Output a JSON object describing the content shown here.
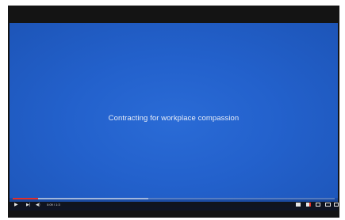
{
  "video": {
    "background_color": "#2361cc",
    "slide_text": "Contracting for workplace compassion"
  },
  "controls": {
    "progress_played_fraction": 0.08,
    "progress_buffered_fraction": 0.42,
    "progress_color": "#e1302a",
    "play_icon": "▶",
    "next_icon": "▶|",
    "volume_icon": "◀)",
    "time_text": "0:09 / 1:3"
  },
  "icons": {
    "play": "play-icon",
    "next": "next-icon",
    "volume": "volume-icon",
    "subtitles": "subtitles-icon",
    "settings": "settings-icon",
    "miniplayer": "miniplayer-icon",
    "theater": "theater-mode-icon",
    "fullscreen": "fullscreen-icon"
  }
}
